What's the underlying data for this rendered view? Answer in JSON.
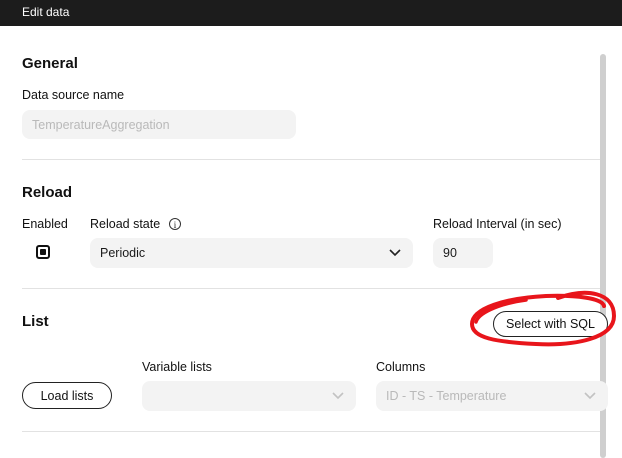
{
  "window": {
    "title": "Edit data"
  },
  "general": {
    "heading": "General",
    "data_source_label": "Data source name",
    "data_source_value": "TemperatureAggregation"
  },
  "reload": {
    "heading": "Reload",
    "enabled_label": "Enabled",
    "enabled_checked": true,
    "state_label": "Reload state",
    "state_value": "Periodic",
    "interval_label": "Reload Interval (in sec)",
    "interval_value": "90"
  },
  "list": {
    "heading": "List",
    "select_sql_label": "Select with SQL",
    "variable_lists_label": "Variable lists",
    "variable_lists_value": "",
    "columns_label": "Columns",
    "columns_value": "ID - TS - Temperature",
    "load_lists_label": "Load lists"
  },
  "annotation": {
    "color": "#e8151b"
  },
  "colors": {
    "titlebar": "#1c1c1c",
    "field_bg": "#f3f3f3",
    "disabled_text": "#b9b9b9"
  }
}
